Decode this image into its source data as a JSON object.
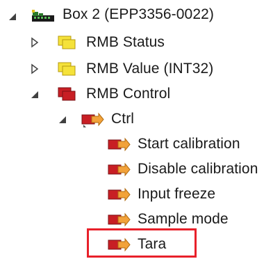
{
  "tree": {
    "items": [
      {
        "id": "box2",
        "label": "Box 2 (EPP3356-0022)",
        "expanded": true,
        "icon": "device-box-icon"
      },
      {
        "id": "rmb-status",
        "label": "RMB Status",
        "expanded": false,
        "icon": "input-folder-icon"
      },
      {
        "id": "rmb-value",
        "label": "RMB Value (INT32)",
        "expanded": false,
        "icon": "input-folder-icon"
      },
      {
        "id": "rmb-control",
        "label": "RMB Control",
        "expanded": true,
        "icon": "output-folder-icon"
      },
      {
        "id": "ctrl",
        "label": "Ctrl",
        "expanded": true,
        "icon": "output-variable-icon"
      },
      {
        "id": "start-calibration",
        "label": "Start calibration",
        "icon": "output-variable-icon"
      },
      {
        "id": "disable-calibration",
        "label": "Disable calibration",
        "icon": "output-variable-icon"
      },
      {
        "id": "input-freeze",
        "label": "Input freeze",
        "icon": "output-variable-icon"
      },
      {
        "id": "sample-mode",
        "label": "Sample mode",
        "icon": "output-variable-icon"
      },
      {
        "id": "tara",
        "label": "Tara",
        "icon": "output-variable-icon",
        "highlighted": true
      }
    ]
  },
  "colors": {
    "highlight": "#e8202a",
    "input_yellow": "#f5e23a",
    "output_red": "#c81e24",
    "arrow_orange": "#f2a23a"
  }
}
